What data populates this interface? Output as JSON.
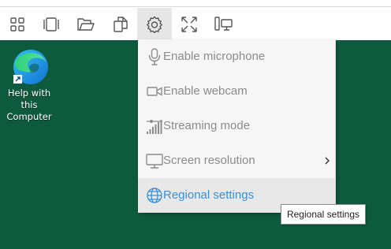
{
  "toolbar": {
    "buttons": [
      {
        "icon": "grid-icon"
      },
      {
        "icon": "carousel-icon"
      },
      {
        "icon": "folder-open-icon"
      },
      {
        "icon": "copy-icon"
      },
      {
        "icon": "gear-icon",
        "active": true
      },
      {
        "icon": "fullscreen-icon"
      },
      {
        "icon": "display-switch-icon"
      }
    ]
  },
  "desktop": {
    "background": "#0e5a3e",
    "shortcut": {
      "label_lines": [
        "Help with",
        "this",
        "Computer"
      ],
      "icon": "edge-browser-icon"
    }
  },
  "settings_menu": {
    "items": [
      {
        "label": "Enable microphone",
        "icon": "microphone-icon"
      },
      {
        "label": "Enable webcam",
        "icon": "webcam-icon"
      },
      {
        "label": "Streaming mode",
        "icon": "streaming-icon"
      },
      {
        "label": "Screen resolution",
        "icon": "monitor-icon",
        "submenu": true
      },
      {
        "label": "Regional settings",
        "icon": "globe-icon",
        "selected": true
      }
    ],
    "accent": "#3b8ed6",
    "disabled_text": "#8c8c8c"
  },
  "tooltip": {
    "text": "Regional settings"
  }
}
